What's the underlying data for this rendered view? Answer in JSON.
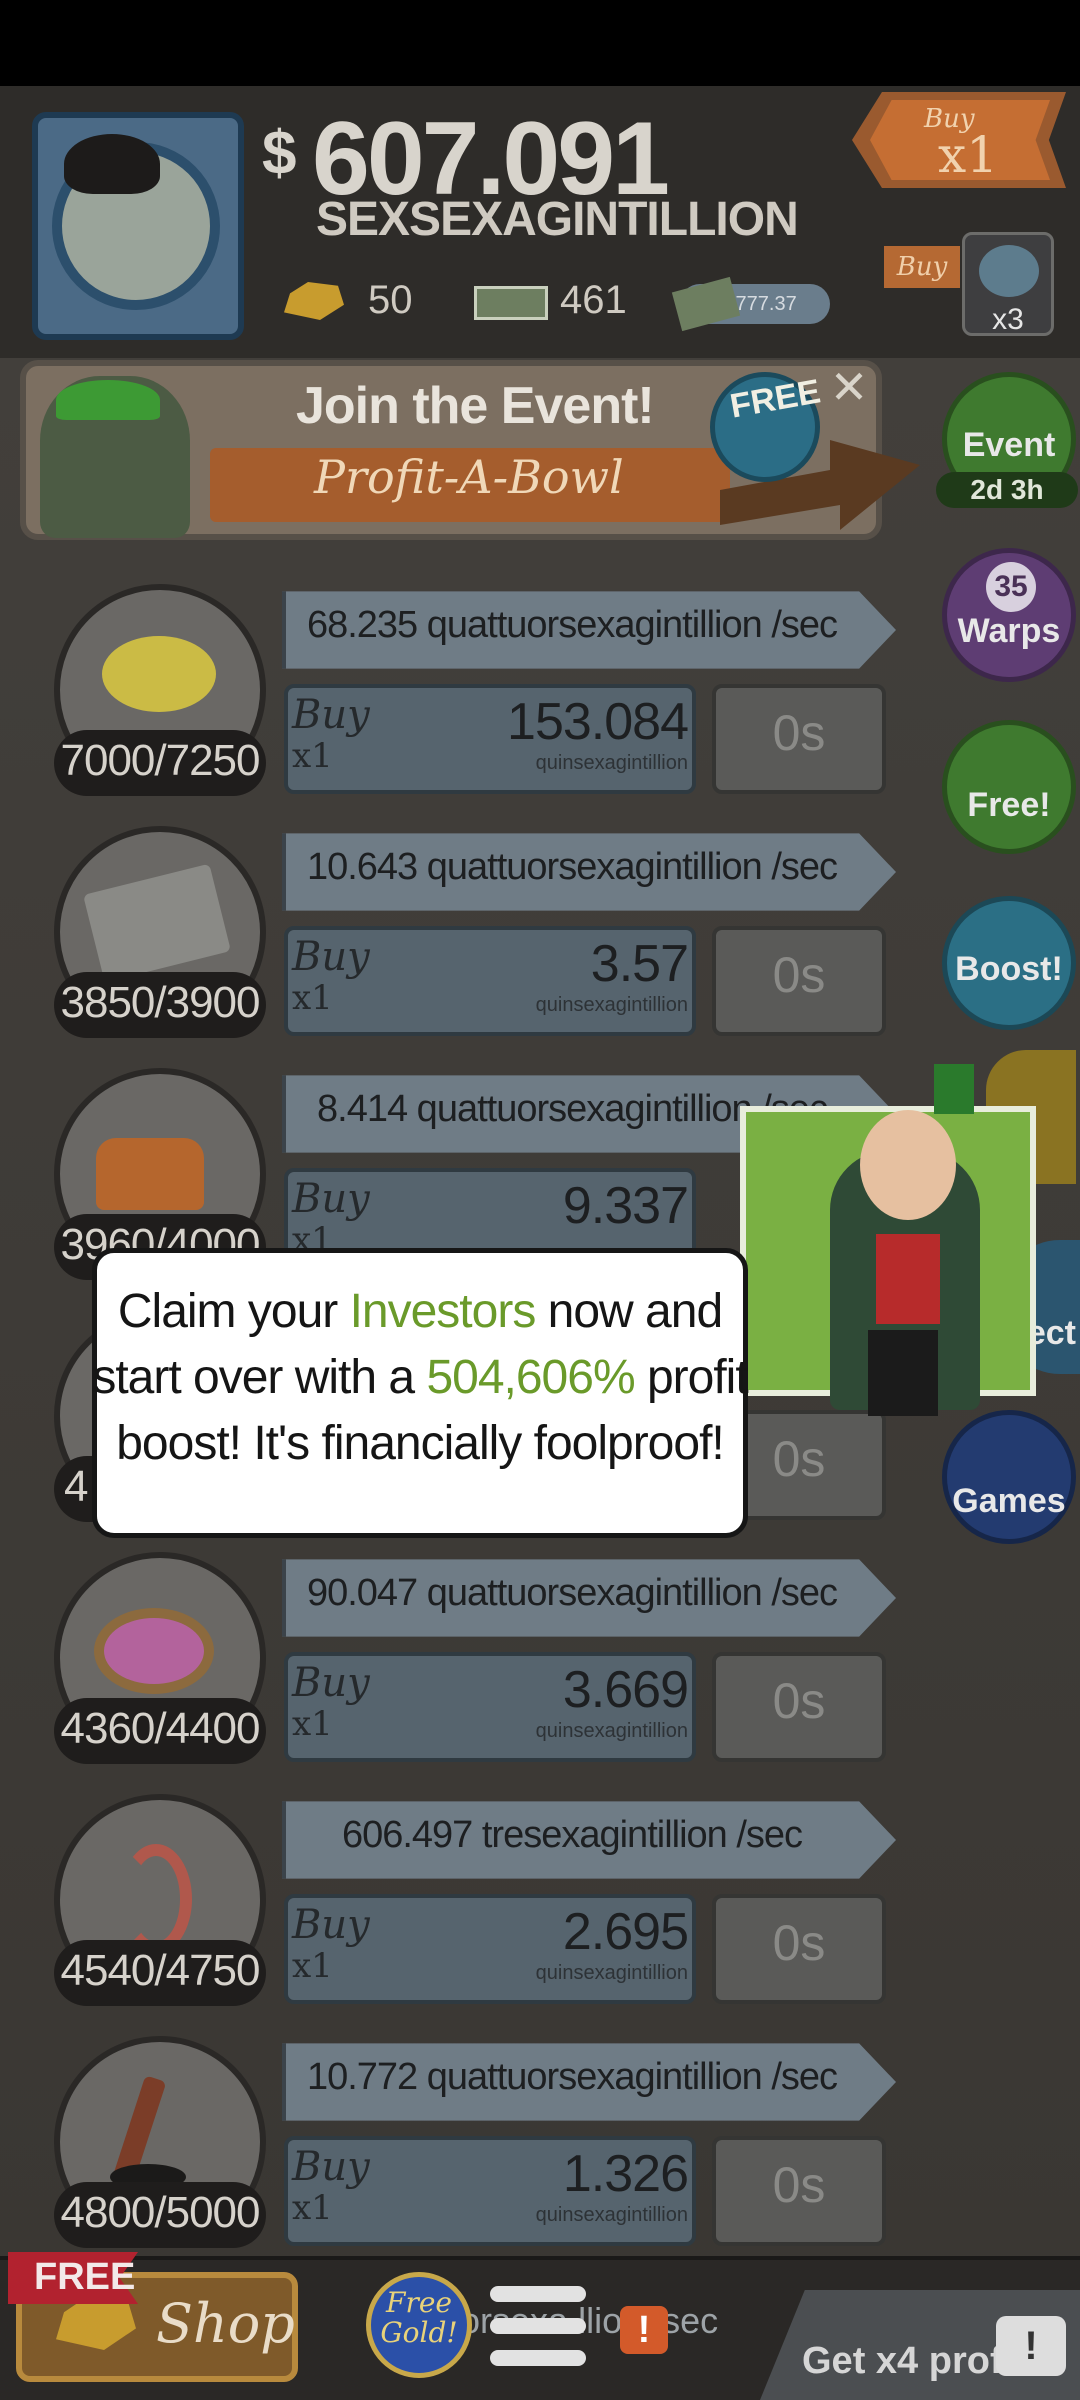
{
  "header": {
    "currency_symbol": "$",
    "money_amount": "607.091",
    "money_unit": "SEXSEXAGINTILLION",
    "gold": "50",
    "angel_bills": "461",
    "megabucks": "37777.37",
    "buy_mode": {
      "label": "Buy",
      "multiplier": "x1"
    },
    "buy_small": {
      "label": "Buy",
      "badge": "x3"
    }
  },
  "event_banner": {
    "title": "Join the Event!",
    "subtitle": "Profit-A-Bowl",
    "free_badge": "FREE",
    "close": "✕"
  },
  "side_menu": {
    "event": {
      "label": "Event",
      "timer": "2d 3h"
    },
    "warps": {
      "label": "Warps",
      "count": "35"
    },
    "free": {
      "label": "Free!"
    },
    "boost": {
      "label": "Boost!"
    },
    "select": {
      "label": "ect"
    },
    "games": {
      "label": "Games"
    }
  },
  "businesses": [
    {
      "icon": "lemon-icon",
      "progress": "7000/7250",
      "profit": "68.235 quattuorsexagintillion /sec",
      "buy_label": "Buy",
      "buy_mult": "x1",
      "cost": "153.084",
      "cost_unit": "quinsexagintillion",
      "timer": "0s"
    },
    {
      "icon": "newspaper-icon",
      "progress": "3850/3900",
      "profit": "10.643 quattuorsexagintillion /sec",
      "buy_label": "Buy",
      "buy_mult": "x1",
      "cost": "3.57",
      "cost_unit": "quinsexagintillion",
      "timer": "0s"
    },
    {
      "icon": "car-icon",
      "progress": "3960/4000",
      "profit": "8.414 quattuorsexagintillion /sec",
      "buy_label": "Buy",
      "buy_mult": "x1",
      "cost": "9.337",
      "cost_unit": "",
      "timer": ""
    },
    {
      "icon": "pizza-icon",
      "progress": "4",
      "profit": "",
      "buy_label": "",
      "buy_mult": "",
      "cost": "",
      "cost_unit": "",
      "timer": "0s"
    },
    {
      "icon": "donut-icon",
      "progress": "4360/4400",
      "profit": "90.047 quattuorsexagintillion /sec",
      "buy_label": "Buy",
      "buy_mult": "x1",
      "cost": "3.669",
      "cost_unit": "quinsexagintillion",
      "timer": "0s"
    },
    {
      "icon": "shrimp-icon",
      "progress": "4540/4750",
      "profit": "606.497 tresexagintillion /sec",
      "buy_label": "Buy",
      "buy_mult": "x1",
      "cost": "2.695",
      "cost_unit": "quinsexagintillion",
      "timer": "0s"
    },
    {
      "icon": "hockey-icon",
      "progress": "4800/5000",
      "profit": "10.772 quattuorsexagintillion /sec",
      "buy_label": "Buy",
      "buy_mult": "x1",
      "cost": "1.326",
      "cost_unit": "quinsexagintillion",
      "timer": "0s"
    }
  ],
  "popup": {
    "line1_a": "Claim your ",
    "line1_hl": "Investors",
    "line1_b": " now and",
    "line2_a": "start over with a ",
    "line2_hl": "504,606%",
    "line2_b": " profit",
    "line3": "boost! It's financially foolproof!"
  },
  "bottom": {
    "free_tag": "FREE",
    "shop": "Shop",
    "free_gold": "Free Gold!",
    "alert": "!",
    "peek_text": "ttuorsexa    llion /sec",
    "x4": "Get x4 profit!",
    "tv_alert": "!"
  },
  "colors": {
    "highlight_green": "#6a9a2a",
    "buy_tag_orange": "#c56e33"
  }
}
